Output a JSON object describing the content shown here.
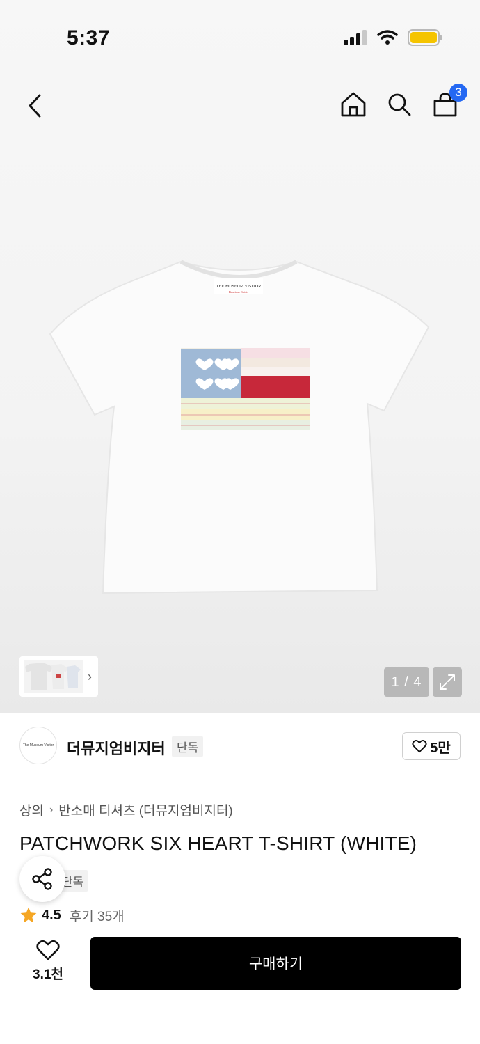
{
  "status_bar": {
    "time": "5:37"
  },
  "nav": {
    "cart_count": "3"
  },
  "gallery": {
    "page_indicator": "1 / 4",
    "current_page": 1,
    "total_pages": 4
  },
  "brand": {
    "name": "더뮤지엄비지터",
    "badge": "단독",
    "likes": "5만",
    "logo_text": "The Museum Visitor"
  },
  "breadcrumb": {
    "category": "상의",
    "subcategory": "반소매 티셔츠 (더뮤지엄비지터)"
  },
  "product": {
    "title": "PATCHWORK SIX HEART T-SHIRT (WHITE)",
    "badge": "단독",
    "rating": "4.5",
    "reviews": "후기 35개",
    "label_line1": "THE MUSEUM VISITOR",
    "label_line2": "Boutique Shirts"
  },
  "bottom": {
    "wish_count": "3.1천",
    "buy_label": "구매하기"
  },
  "colors": {
    "badge_blue": "#2468f2",
    "battery_yellow": "#f5c400",
    "star_orange": "#f5a623",
    "buy_button": "#000000"
  }
}
